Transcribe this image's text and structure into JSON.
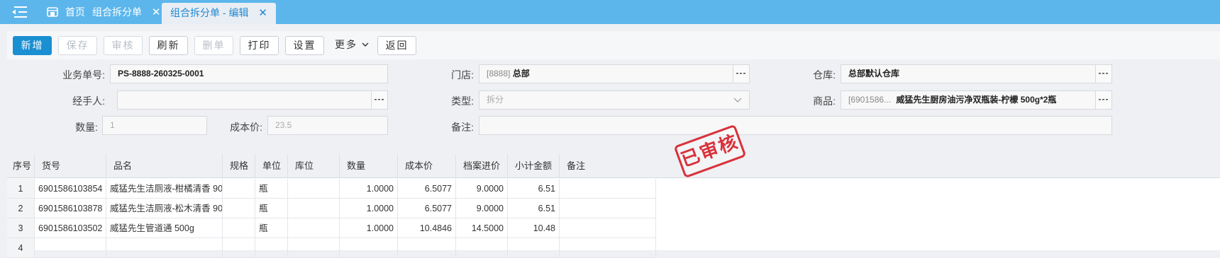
{
  "tabs": {
    "home": "首页",
    "list": "组合拆分单",
    "edit": "组合拆分单 - 编辑",
    "close": "✕"
  },
  "toolbar": {
    "add": "新增",
    "save": "保存",
    "audit": "审核",
    "refresh": "刷新",
    "delete": "删单",
    "print": "打印",
    "settings": "设置",
    "more": "更多",
    "back": "返回"
  },
  "form": {
    "doc_no_label": "业务单号:",
    "doc_no": "PS-8888-260325-0001",
    "store_label": "门店:",
    "store_code": "[8888]",
    "store_name": "总部",
    "warehouse_label": "仓库:",
    "warehouse": "总部默认仓库",
    "handler_label": "经手人:",
    "handler": "",
    "type_label": "类型:",
    "type": "拆分",
    "product_label": "商品:",
    "product_code": "[6901586...",
    "product_name": "威猛先生厨房油污净双瓶装-柠檬 500g*2瓶",
    "qty_label": "数量:",
    "qty": "1",
    "cost_label": "成本价:",
    "cost": "23.5",
    "remark_label": "备注:",
    "remark": "",
    "dots": "---"
  },
  "stamp": "已审核",
  "table": {
    "headers": [
      "序号",
      "货号",
      "品名",
      "规格",
      "单位",
      "库位",
      "数量",
      "成本价",
      "档案进价",
      "小计金额",
      "备注"
    ],
    "rows": [
      {
        "idx": "1",
        "code": "6901586103854",
        "name": "威猛先生洁厕液-柑橘清香 90...",
        "spec": "",
        "unit": "瓶",
        "loc": "",
        "qty": "1.0000",
        "cost": "6.5077",
        "price": "9.0000",
        "subtotal": "6.51",
        "remark": ""
      },
      {
        "idx": "2",
        "code": "6901586103878",
        "name": "威猛先生洁厕液-松木清香 90...",
        "spec": "",
        "unit": "瓶",
        "loc": "",
        "qty": "1.0000",
        "cost": "6.5077",
        "price": "9.0000",
        "subtotal": "6.51",
        "remark": ""
      },
      {
        "idx": "3",
        "code": "6901586103502",
        "name": "威猛先生管道通 500g",
        "spec": "",
        "unit": "瓶",
        "loc": "",
        "qty": "1.0000",
        "cost": "10.4846",
        "price": "14.5000",
        "subtotal": "10.48",
        "remark": ""
      },
      {
        "idx": "4",
        "code": "",
        "name": "",
        "spec": "",
        "unit": "",
        "loc": "",
        "qty": "",
        "cost": "",
        "price": "",
        "subtotal": "",
        "remark": ""
      }
    ]
  }
}
